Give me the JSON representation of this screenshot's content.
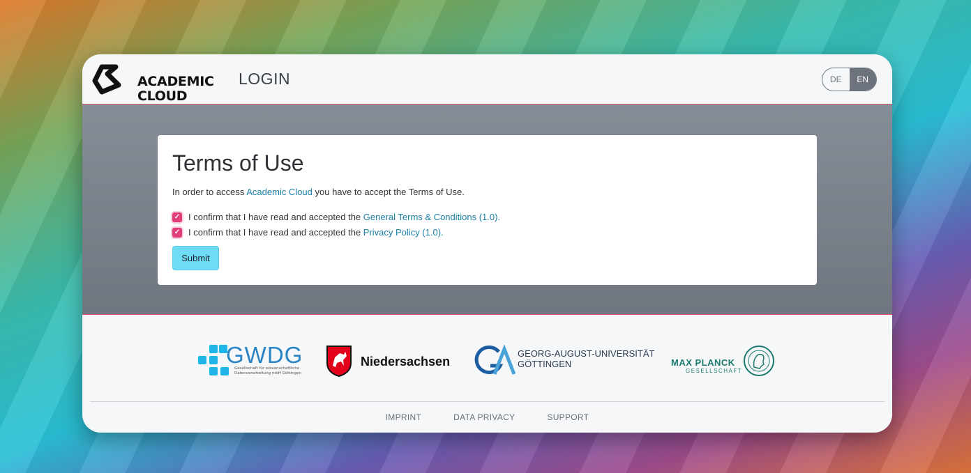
{
  "header": {
    "logo_line1": "ACADEMIC",
    "logo_line2": "CLOUD",
    "page_heading": "LOGIN",
    "lang": {
      "de": "DE",
      "en": "EN",
      "active": "EN"
    }
  },
  "terms": {
    "title": "Terms of Use",
    "intro_prefix": "In order to access ",
    "intro_link": "Academic Cloud",
    "intro_suffix": " you have to accept the Terms of Use.",
    "checks": [
      {
        "prefix": "I confirm that I have read and accepted the ",
        "link": "General Terms & Conditions (1.0)",
        "suffix": ".",
        "checked": true
      },
      {
        "prefix": "I confirm that I have read and accepted the ",
        "link": "Privacy Policy (1.0)",
        "suffix": ".",
        "checked": true
      }
    ],
    "submit_label": "Submit"
  },
  "partners": {
    "gwdg_title": "GWDG",
    "gwdg_sub": "Gesellschaft für wissenschaftliche Datenverarbeitung mbH Göttingen",
    "niedersachsen": "Niedersachsen",
    "goettingen_line1": "GEORG-AUGUST-UNIVERSITÄT",
    "goettingen_line2": "GÖTTINGEN",
    "mpg_title": "MAX PLANCK",
    "mpg_sub": "GESELLSCHAFT"
  },
  "footer": {
    "imprint": "IMPRINT",
    "data_privacy": "DATA PRIVACY",
    "support": "SUPPORT"
  },
  "colors": {
    "accent_pink": "#e23d78",
    "link": "#1a7fa6",
    "submit_bg": "#6fdcf5",
    "main_bg": "#7d838c"
  }
}
